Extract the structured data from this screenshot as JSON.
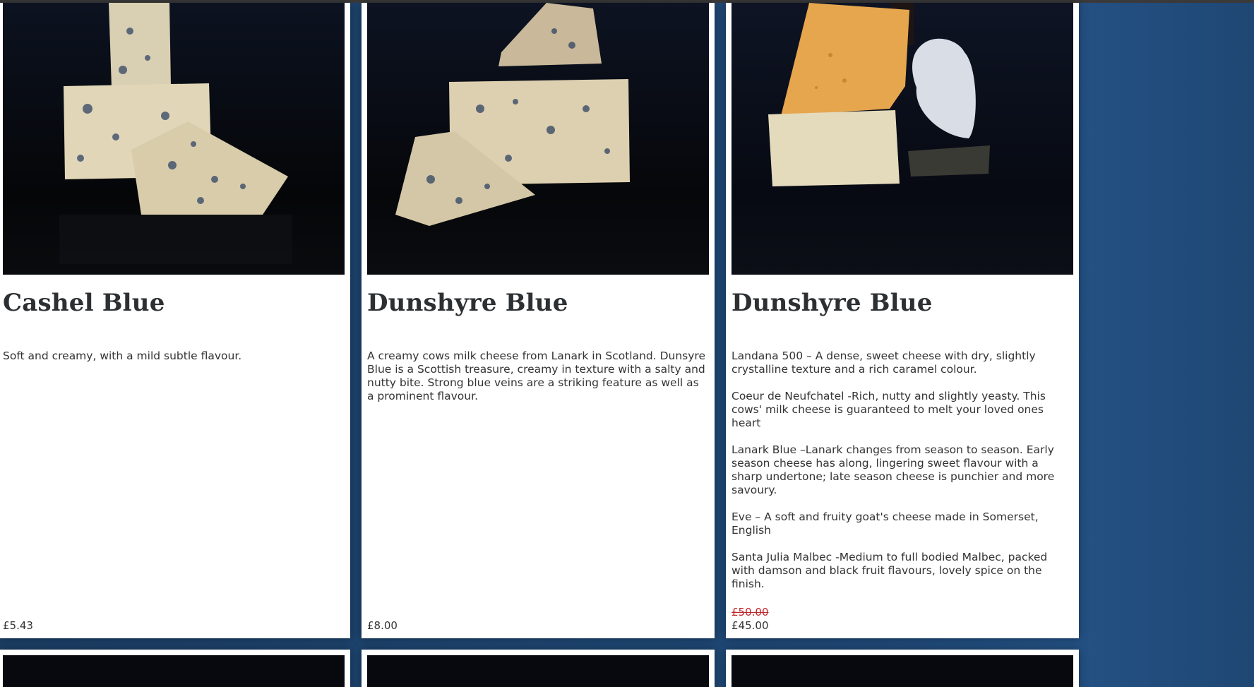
{
  "products": [
    {
      "title": "Cashel Blue",
      "description": [
        "Soft and creamy, with a mild subtle flavour."
      ],
      "price": "£5.43"
    },
    {
      "title": "Dunshyre Blue",
      "description": [
        "A creamy cows milk cheese from Lanark in Scotland. Dunsyre Blue is a Scottish treasure, creamy in texture with a salty and nutty bite. Strong blue veins are a striking feature as well as a prominent flavour."
      ],
      "price": "£8.00"
    },
    {
      "title": "Dunshyre Blue",
      "description": [
        "Landana 500 – A dense, sweet cheese with dry, slightly crystalline texture and a rich caramel colour.",
        "Coeur de Neufchatel -Rich, nutty and slightly yeasty. This cows' milk cheese is guaranteed to melt your loved ones heart",
        "Lanark Blue –Lanark changes from season to season. Early season cheese has along, lingering sweet flavour with a sharp undertone; late season cheese is punchier and more savoury.",
        "Eve – A soft and fruity goat's cheese made in Somerset, English",
        "Santa Julia Malbec -Medium to full bodied Malbec, packed with damson and black fruit flavours, lovely spice on the finish."
      ],
      "original_price": "£50.00",
      "price": "£45.00"
    }
  ],
  "colors": {
    "background": "#1e4a7a",
    "card": "#ffffff",
    "text": "#333333",
    "title": "#2d3033",
    "sale_strike": "#c0282d"
  }
}
